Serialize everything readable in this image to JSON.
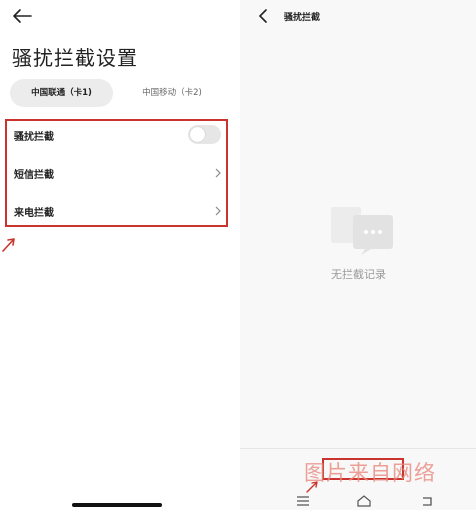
{
  "left_screen": {
    "title": "骚扰拦截设置",
    "tabs": [
      {
        "label": "中国联通（卡1)",
        "selected": true
      },
      {
        "label": "中国移动（卡2)",
        "selected": false
      }
    ],
    "settings": [
      {
        "label": "骚扰拦截",
        "control": "toggle",
        "enabled": false
      },
      {
        "label": "短信拦截",
        "control": "chevron"
      },
      {
        "label": "来电拦截",
        "control": "chevron"
      }
    ]
  },
  "right_screen": {
    "title": "骚扰拦截",
    "empty_text": "无拦截记录",
    "watermark": "图片来自网络"
  },
  "colors": {
    "highlight_red": "#c9352e",
    "watermark": "#e98a7f",
    "muted_text": "#999999"
  },
  "icons": [
    "back-arrow-icon",
    "chevron-right-icon",
    "empty-messages-icon",
    "menu-icon",
    "home-icon",
    "back-nav-icon"
  ]
}
